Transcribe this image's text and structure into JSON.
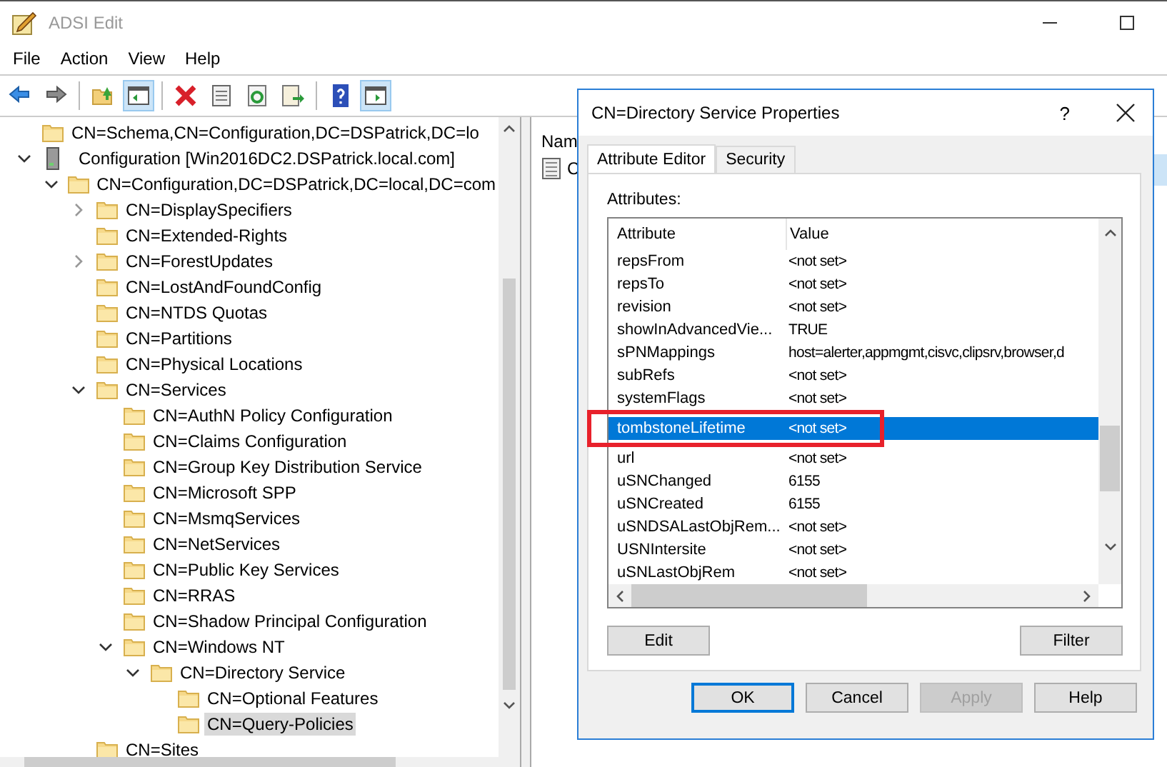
{
  "window": {
    "title": "ADSI Edit"
  },
  "menu": [
    "File",
    "Action",
    "View",
    "Help"
  ],
  "toolbar": [
    {
      "kind": "back",
      "pressed": false
    },
    {
      "kind": "forward",
      "pressed": false
    },
    {
      "kind": "sep"
    },
    {
      "kind": "up",
      "pressed": false
    },
    {
      "kind": "tree",
      "pressed": true
    },
    {
      "kind": "sep"
    },
    {
      "kind": "delete",
      "pressed": false
    },
    {
      "kind": "properties",
      "pressed": false
    },
    {
      "kind": "refresh",
      "pressed": false
    },
    {
      "kind": "export",
      "pressed": false
    },
    {
      "kind": "sep"
    },
    {
      "kind": "help",
      "pressed": false
    },
    {
      "kind": "action",
      "pressed": true
    }
  ],
  "tree": [
    {
      "label": "CN=Schema,CN=Configuration,DC=DSPatrick,DC=lo",
      "kind": "folder",
      "selected": false
    },
    {
      "label": "Configuration [Win2016DC2.DSPatrick.local.com]",
      "kind": "server",
      "expanded": true,
      "selected": false,
      "children": [
        {
          "label": "CN=Configuration,DC=DSPatrick,DC=local,DC=com",
          "kind": "folder",
          "expanded": true,
          "selected": false,
          "children": [
            {
              "label": "CN=DisplaySpecifiers",
              "kind": "folder",
              "expanded": false,
              "selected": false
            },
            {
              "label": "CN=Extended-Rights",
              "kind": "folder",
              "selected": false
            },
            {
              "label": "CN=ForestUpdates",
              "kind": "folder",
              "expanded": false,
              "selected": false
            },
            {
              "label": "CN=LostAndFoundConfig",
              "kind": "folder",
              "selected": false
            },
            {
              "label": "CN=NTDS Quotas",
              "kind": "folder",
              "selected": false
            },
            {
              "label": "CN=Partitions",
              "kind": "folder",
              "selected": false
            },
            {
              "label": "CN=Physical Locations",
              "kind": "folder",
              "selected": false
            },
            {
              "label": "CN=Services",
              "kind": "folder",
              "expanded": true,
              "selected": false,
              "children": [
                {
                  "label": "CN=AuthN Policy Configuration",
                  "kind": "folder",
                  "selected": false
                },
                {
                  "label": "CN=Claims Configuration",
                  "kind": "folder",
                  "selected": false
                },
                {
                  "label": "CN=Group Key Distribution Service",
                  "kind": "folder",
                  "selected": false
                },
                {
                  "label": "CN=Microsoft SPP",
                  "kind": "folder",
                  "selected": false
                },
                {
                  "label": "CN=MsmqServices",
                  "kind": "folder",
                  "selected": false
                },
                {
                  "label": "CN=NetServices",
                  "kind": "folder",
                  "selected": false
                },
                {
                  "label": "CN=Public Key Services",
                  "kind": "folder",
                  "selected": false
                },
                {
                  "label": "CN=RRAS",
                  "kind": "folder",
                  "selected": false
                },
                {
                  "label": "CN=Shadow Principal Configuration",
                  "kind": "folder",
                  "selected": false
                },
                {
                  "label": "CN=Windows NT",
                  "kind": "folder",
                  "expanded": true,
                  "selected": false,
                  "children": [
                    {
                      "label": "CN=Directory Service",
                      "kind": "folder",
                      "expanded": true,
                      "selected": false,
                      "children": [
                        {
                          "label": "CN=Optional Features",
                          "kind": "folder",
                          "selected": false
                        },
                        {
                          "label": "CN=Query-Policies",
                          "kind": "folder",
                          "selected": true
                        }
                      ]
                    }
                  ]
                }
              ]
            },
            {
              "label": "CN=Sites",
              "kind": "folder",
              "selected": false
            }
          ]
        }
      ]
    }
  ],
  "result_pane": {
    "column_header": "Nam",
    "items": [
      "C"
    ]
  },
  "dialog": {
    "title": "CN=Directory Service Properties",
    "help_glyph": "?",
    "tabs": [
      {
        "label": "Attribute Editor",
        "selected": true
      },
      {
        "label": "Security",
        "selected": false
      }
    ],
    "attributes_label": "Attributes:",
    "columns": [
      "Attribute",
      "Value"
    ],
    "rows": [
      {
        "attribute": "repsFrom",
        "value": "<not set>",
        "selected": false
      },
      {
        "attribute": "repsTo",
        "value": "<not set>",
        "selected": false
      },
      {
        "attribute": "revision",
        "value": "<not set>",
        "selected": false
      },
      {
        "attribute": "showInAdvancedVie...",
        "value": "TRUE",
        "selected": false
      },
      {
        "attribute": "sPNMappings",
        "value": "host=alerter,appmgmt,cisvc,clipsrv,browser,d",
        "selected": false
      },
      {
        "attribute": "subRefs",
        "value": "<not set>",
        "selected": false
      },
      {
        "attribute": "systemFlags",
        "value": "<not set>",
        "selected": false
      },
      {
        "attribute": "tombstoneLifetime",
        "value": "<not set>",
        "selected": true,
        "marked": true
      },
      {
        "attribute": "url",
        "value": "<not set>",
        "selected": false
      },
      {
        "attribute": "uSNChanged",
        "value": "6155",
        "selected": false
      },
      {
        "attribute": "uSNCreated",
        "value": "6155",
        "selected": false
      },
      {
        "attribute": "uSNDSALastObjRem...",
        "value": "<not set>",
        "selected": false
      },
      {
        "attribute": "USNIntersite",
        "value": "<not set>",
        "selected": false
      },
      {
        "attribute": "uSNLastObjRem",
        "value": "<not set>",
        "selected": false
      }
    ],
    "list_buttons": [
      "Edit",
      "Filter"
    ],
    "buttons": [
      {
        "label": "OK",
        "default": true,
        "disabled": false
      },
      {
        "label": "Cancel",
        "default": false,
        "disabled": false
      },
      {
        "label": "Apply",
        "default": false,
        "disabled": true
      },
      {
        "label": "Help",
        "default": false,
        "disabled": false
      }
    ]
  }
}
